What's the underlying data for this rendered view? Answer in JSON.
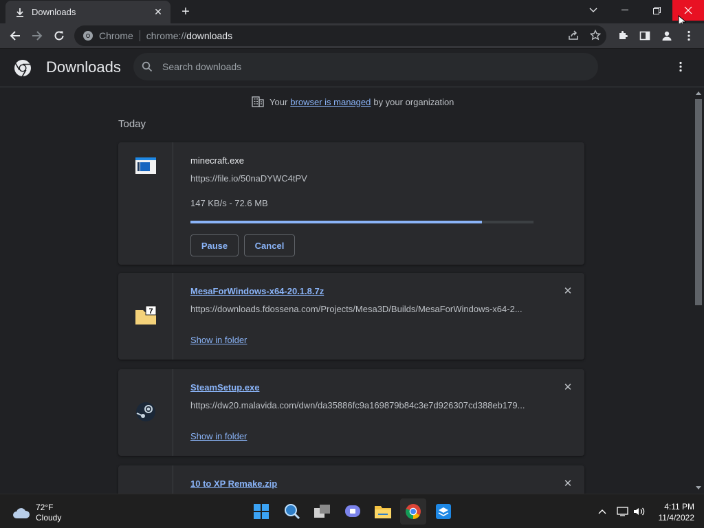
{
  "window": {
    "tab_title": "Downloads",
    "tab_close": "✕",
    "new_tab": "+"
  },
  "toolbar": {
    "site_label": "Chrome",
    "url_scheme": "chrome://",
    "url_host": "downloads"
  },
  "page": {
    "title": "Downloads",
    "search_placeholder": "Search downloads",
    "managed_prefix": "Your",
    "managed_link": "browser is managed",
    "managed_suffix": "by your organization",
    "section": "Today"
  },
  "downloads": [
    {
      "name": "minecraft.exe",
      "url": "https://file.io/50naDYWC4tPV",
      "status": "147 KB/s - 72.6 MB",
      "progress_fraction": 0.85,
      "pause_label": "Pause",
      "cancel_label": "Cancel"
    },
    {
      "name": "MesaForWindows-x64-20.1.8.7z",
      "url": "https://downloads.fdossena.com/Projects/Mesa3D/Builds/MesaForWindows-x64-2...",
      "action": "Show in folder",
      "icon_label": "7"
    },
    {
      "name": "SteamSetup.exe",
      "url": "https://dw20.malavida.com/dwn/da35886fc9a169879b84c3e7d926307cd388eb179...",
      "action": "Show in folder"
    },
    {
      "name": "10 to XP Remake.zip"
    }
  ],
  "taskbar": {
    "temp": "72°F",
    "condition": "Cloudy",
    "time": "4:11 PM",
    "date": "11/4/2022"
  },
  "colors": {
    "accent": "#8ab4f8",
    "close_hover": "#e81123"
  }
}
